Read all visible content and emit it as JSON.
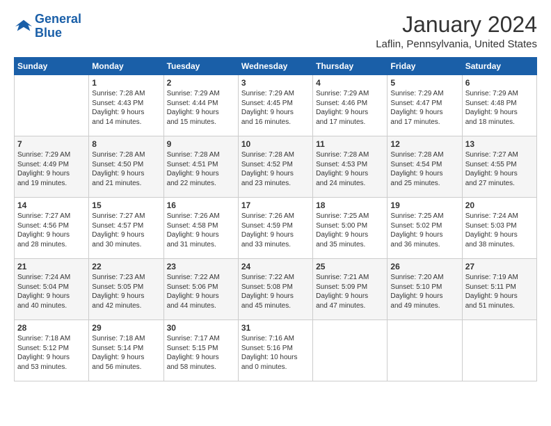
{
  "logo": {
    "line1": "General",
    "line2": "Blue"
  },
  "header": {
    "title": "January 2024",
    "location": "Laflin, Pennsylvania, United States"
  },
  "weekdays": [
    "Sunday",
    "Monday",
    "Tuesday",
    "Wednesday",
    "Thursday",
    "Friday",
    "Saturday"
  ],
  "weeks": [
    [
      {
        "day": "",
        "info": ""
      },
      {
        "day": "1",
        "info": "Sunrise: 7:28 AM\nSunset: 4:43 PM\nDaylight: 9 hours\nand 14 minutes."
      },
      {
        "day": "2",
        "info": "Sunrise: 7:29 AM\nSunset: 4:44 PM\nDaylight: 9 hours\nand 15 minutes."
      },
      {
        "day": "3",
        "info": "Sunrise: 7:29 AM\nSunset: 4:45 PM\nDaylight: 9 hours\nand 16 minutes."
      },
      {
        "day": "4",
        "info": "Sunrise: 7:29 AM\nSunset: 4:46 PM\nDaylight: 9 hours\nand 17 minutes."
      },
      {
        "day": "5",
        "info": "Sunrise: 7:29 AM\nSunset: 4:47 PM\nDaylight: 9 hours\nand 17 minutes."
      },
      {
        "day": "6",
        "info": "Sunrise: 7:29 AM\nSunset: 4:48 PM\nDaylight: 9 hours\nand 18 minutes."
      }
    ],
    [
      {
        "day": "7",
        "info": "Sunrise: 7:29 AM\nSunset: 4:49 PM\nDaylight: 9 hours\nand 19 minutes."
      },
      {
        "day": "8",
        "info": "Sunrise: 7:28 AM\nSunset: 4:50 PM\nDaylight: 9 hours\nand 21 minutes."
      },
      {
        "day": "9",
        "info": "Sunrise: 7:28 AM\nSunset: 4:51 PM\nDaylight: 9 hours\nand 22 minutes."
      },
      {
        "day": "10",
        "info": "Sunrise: 7:28 AM\nSunset: 4:52 PM\nDaylight: 9 hours\nand 23 minutes."
      },
      {
        "day": "11",
        "info": "Sunrise: 7:28 AM\nSunset: 4:53 PM\nDaylight: 9 hours\nand 24 minutes."
      },
      {
        "day": "12",
        "info": "Sunrise: 7:28 AM\nSunset: 4:54 PM\nDaylight: 9 hours\nand 25 minutes."
      },
      {
        "day": "13",
        "info": "Sunrise: 7:27 AM\nSunset: 4:55 PM\nDaylight: 9 hours\nand 27 minutes."
      }
    ],
    [
      {
        "day": "14",
        "info": "Sunrise: 7:27 AM\nSunset: 4:56 PM\nDaylight: 9 hours\nand 28 minutes."
      },
      {
        "day": "15",
        "info": "Sunrise: 7:27 AM\nSunset: 4:57 PM\nDaylight: 9 hours\nand 30 minutes."
      },
      {
        "day": "16",
        "info": "Sunrise: 7:26 AM\nSunset: 4:58 PM\nDaylight: 9 hours\nand 31 minutes."
      },
      {
        "day": "17",
        "info": "Sunrise: 7:26 AM\nSunset: 4:59 PM\nDaylight: 9 hours\nand 33 minutes."
      },
      {
        "day": "18",
        "info": "Sunrise: 7:25 AM\nSunset: 5:00 PM\nDaylight: 9 hours\nand 35 minutes."
      },
      {
        "day": "19",
        "info": "Sunrise: 7:25 AM\nSunset: 5:02 PM\nDaylight: 9 hours\nand 36 minutes."
      },
      {
        "day": "20",
        "info": "Sunrise: 7:24 AM\nSunset: 5:03 PM\nDaylight: 9 hours\nand 38 minutes."
      }
    ],
    [
      {
        "day": "21",
        "info": "Sunrise: 7:24 AM\nSunset: 5:04 PM\nDaylight: 9 hours\nand 40 minutes."
      },
      {
        "day": "22",
        "info": "Sunrise: 7:23 AM\nSunset: 5:05 PM\nDaylight: 9 hours\nand 42 minutes."
      },
      {
        "day": "23",
        "info": "Sunrise: 7:22 AM\nSunset: 5:06 PM\nDaylight: 9 hours\nand 44 minutes."
      },
      {
        "day": "24",
        "info": "Sunrise: 7:22 AM\nSunset: 5:08 PM\nDaylight: 9 hours\nand 45 minutes."
      },
      {
        "day": "25",
        "info": "Sunrise: 7:21 AM\nSunset: 5:09 PM\nDaylight: 9 hours\nand 47 minutes."
      },
      {
        "day": "26",
        "info": "Sunrise: 7:20 AM\nSunset: 5:10 PM\nDaylight: 9 hours\nand 49 minutes."
      },
      {
        "day": "27",
        "info": "Sunrise: 7:19 AM\nSunset: 5:11 PM\nDaylight: 9 hours\nand 51 minutes."
      }
    ],
    [
      {
        "day": "28",
        "info": "Sunrise: 7:18 AM\nSunset: 5:12 PM\nDaylight: 9 hours\nand 53 minutes."
      },
      {
        "day": "29",
        "info": "Sunrise: 7:18 AM\nSunset: 5:14 PM\nDaylight: 9 hours\nand 56 minutes."
      },
      {
        "day": "30",
        "info": "Sunrise: 7:17 AM\nSunset: 5:15 PM\nDaylight: 9 hours\nand 58 minutes."
      },
      {
        "day": "31",
        "info": "Sunrise: 7:16 AM\nSunset: 5:16 PM\nDaylight: 10 hours\nand 0 minutes."
      },
      {
        "day": "",
        "info": ""
      },
      {
        "day": "",
        "info": ""
      },
      {
        "day": "",
        "info": ""
      }
    ]
  ]
}
